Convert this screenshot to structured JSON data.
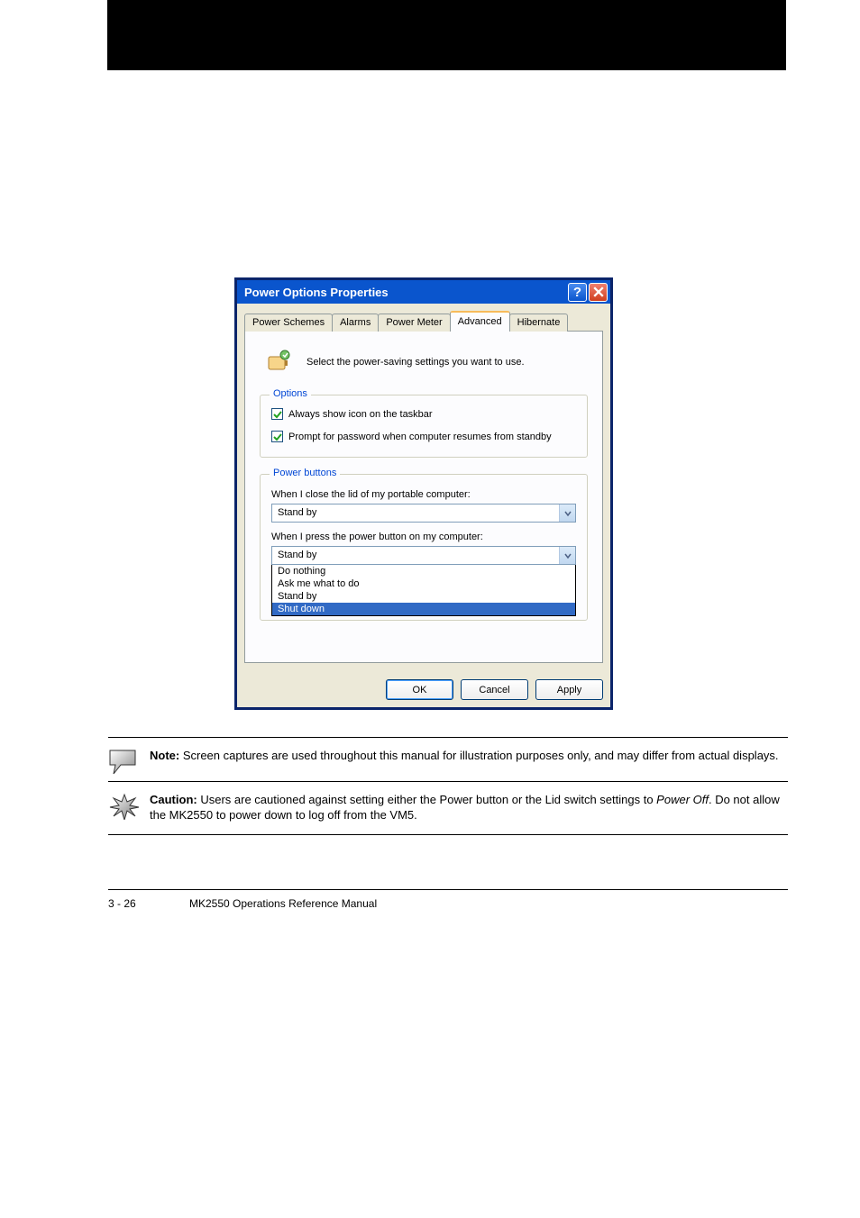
{
  "dialog": {
    "title": "Power Options Properties",
    "tabs": [
      "Power Schemes",
      "Alarms",
      "Power Meter",
      "Advanced",
      "Hibernate"
    ],
    "instruction": "Select the power-saving settings you want to use.",
    "options": {
      "legend": "Options",
      "chk1": "Always show icon on the taskbar",
      "chk2": "Prompt for password when computer resumes from standby"
    },
    "pbuttons": {
      "legend": "Power buttons",
      "lidLabel": "When I close the lid of my portable computer:",
      "lidValue": "Stand by",
      "pwrLabel": "When I press the power button on my computer:",
      "pwrValue": "Stand by",
      "options": [
        "Do nothing",
        "Ask me what to do",
        "Stand by",
        "Shut down"
      ]
    },
    "buttons": {
      "ok": "OK",
      "cancel": "Cancel",
      "apply": "Apply"
    }
  },
  "note": {
    "label": "Note:",
    "text": " Screen captures are used throughout this manual for illustration purposes only, and may differ from actual displays."
  },
  "caution": {
    "label": "Caution:",
    "text1": " Users are cautioned against setting either the Power button or the Lid switch settings to ",
    "em": "Power Off",
    "text2": ". Do not allow the MK2550 to power down to log off from the VM5."
  },
  "footer": {
    "page": "3 - 26",
    "manual": "MK2550 Operations Reference Manual"
  }
}
